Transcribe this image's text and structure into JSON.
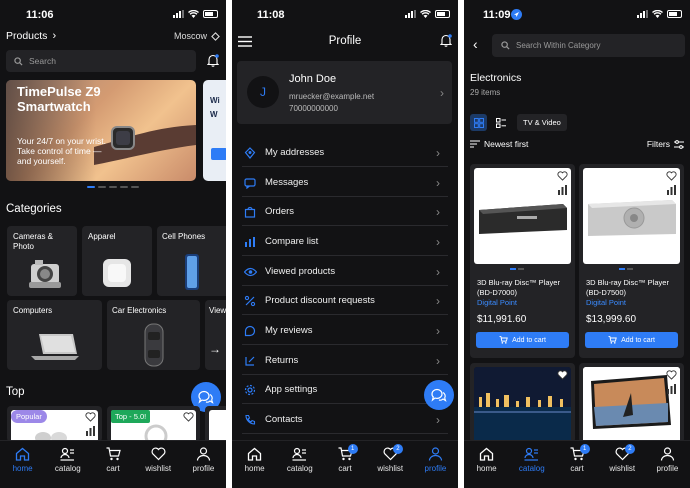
{
  "screen1": {
    "time": "11:06",
    "header_title": "Products",
    "location": "Moscow",
    "search_placeholder": "Search",
    "banner_title": "TimePulse Z9 Smartwatch",
    "banner_text": "Your 24/7 on your wrist. Take control of time — and yourself.",
    "banner2_text": "Wi W",
    "categories_title": "Categories",
    "categories": [
      "Cameras & Photo",
      "Apparel",
      "Cell Phones",
      "Computers",
      "Car Electronics",
      "View"
    ],
    "top_title": "Top",
    "top_badges": [
      "Popular",
      "Top - 5.0!"
    ],
    "nav": [
      "home",
      "catalog",
      "cart",
      "wishlist",
      "profile"
    ],
    "active_nav": "home"
  },
  "screen2": {
    "time": "11:08",
    "title": "Profile",
    "user_initial": "J",
    "user_name": "John Doe",
    "user_email": "mruecker@example.net",
    "user_phone": "70000000000",
    "menu": [
      {
        "label": "My addresses",
        "icon": "address-icon"
      },
      {
        "label": "Messages",
        "icon": "messages-icon"
      },
      {
        "label": "Orders",
        "icon": "orders-icon"
      },
      {
        "label": "Compare list",
        "icon": "compare-icon"
      },
      {
        "label": "Viewed products",
        "icon": "eye-icon"
      },
      {
        "label": "Product discount requests",
        "icon": "discount-icon"
      },
      {
        "label": "My reviews",
        "icon": "reviews-icon"
      },
      {
        "label": "Returns",
        "icon": "returns-icon"
      },
      {
        "label": "App settings",
        "icon": "settings-icon"
      },
      {
        "label": "Contacts",
        "icon": "contacts-icon"
      }
    ],
    "nav": [
      "home",
      "catalog",
      "cart",
      "wishlist",
      "profile"
    ],
    "active_nav": "profile",
    "cart_count": "1",
    "wishlist_count": "2"
  },
  "screen3": {
    "time": "11:09",
    "search_placeholder": "Search Within Category",
    "category_title": "Electronics",
    "item_count": "29 items",
    "filter_chip": "TV & Video",
    "sort_label": "Newest first",
    "filters_label": "Filters",
    "products": [
      {
        "name": "3D Blu-ray Disc™ Player (BD-D7000)",
        "brand": "Digital Point",
        "price": "$11,991.60",
        "cta": "Add to cart"
      },
      {
        "name": "3D Blu-ray Disc™ Player (BD-D7500)",
        "brand": "Digital Point",
        "price": "$13,999.60",
        "cta": "Add to cart"
      }
    ],
    "nav": [
      "home",
      "catalog",
      "cart",
      "wishlist",
      "profile"
    ],
    "active_nav": "catalog",
    "cart_count": "1",
    "wishlist_count": "2"
  },
  "colors": {
    "accent": "#2e7cf6",
    "bg": "#121214",
    "card": "#232326",
    "brand_text": "#3a8bff"
  }
}
